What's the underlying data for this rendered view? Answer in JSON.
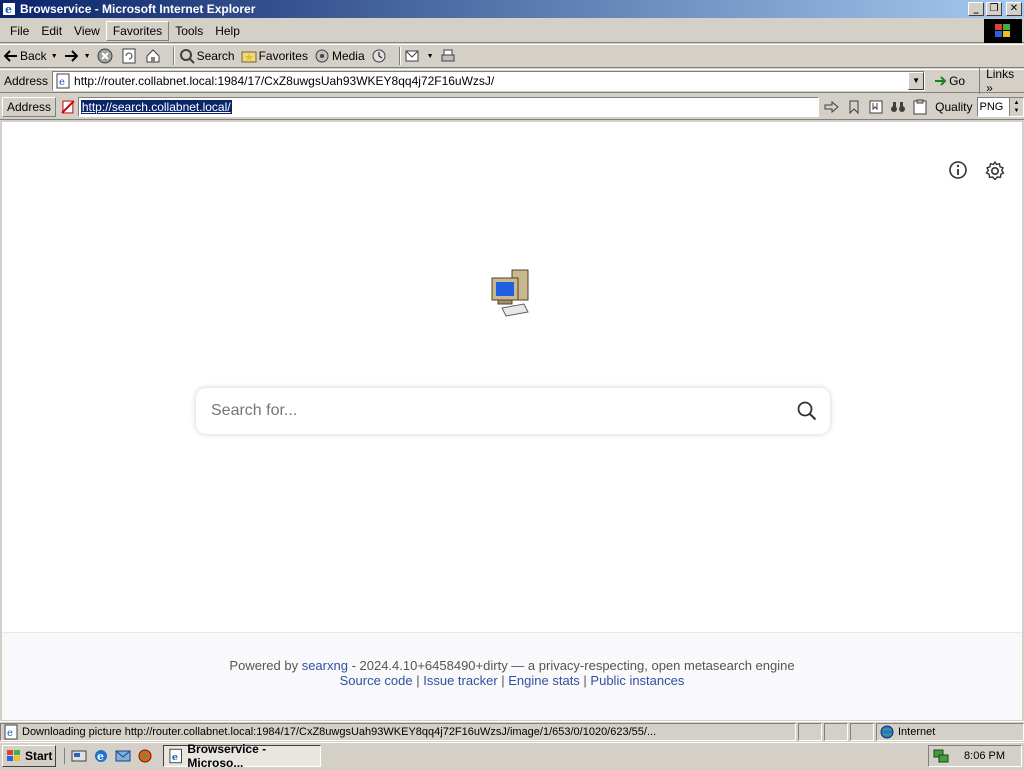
{
  "window": {
    "title": "Browservice - Microsoft Internet Explorer",
    "buttons": [
      "_",
      "❐",
      "✕"
    ]
  },
  "menu": {
    "items": [
      "File",
      "Edit",
      "View",
      "Favorites",
      "Tools",
      "Help"
    ]
  },
  "toolbar": {
    "back": "Back",
    "search": "Search",
    "favorites": "Favorites",
    "media": "Media"
  },
  "address": {
    "label": "Address",
    "url": "http://router.collabnet.local:1984/17/CxZ8uwgsUah93WKEY8qq4j72F16uWzsJ/",
    "go": "Go",
    "links": "Links"
  },
  "browservice": {
    "label": "Address",
    "url": "http://search.collabnet.local/",
    "quality_label": "Quality",
    "quality_value": "PNG"
  },
  "page": {
    "search_placeholder": "Search for...",
    "footer": {
      "powered_by": "Powered by",
      "engine_link": "searxng",
      "version_text": " - 2024.4.10+6458490+dirty — a privacy-respecting, open metasearch engine",
      "links": [
        "Source code",
        "Issue tracker",
        "Engine stats",
        "Public instances"
      ],
      "separator": " | "
    }
  },
  "status": {
    "text": "Downloading picture http://router.collabnet.local:1984/17/CxZ8uwgsUah93WKEY8qq4j72F16uWzsJ/image/1/653/0/1020/623/55/...",
    "zone": "Internet"
  },
  "taskbar": {
    "start": "Start",
    "task": "Browservice - Microso...",
    "clock": "8:06 PM"
  },
  "colors": {
    "titlebar_start": "#0a246a",
    "titlebar_end": "#a6caf0",
    "link": "#3050a0"
  }
}
